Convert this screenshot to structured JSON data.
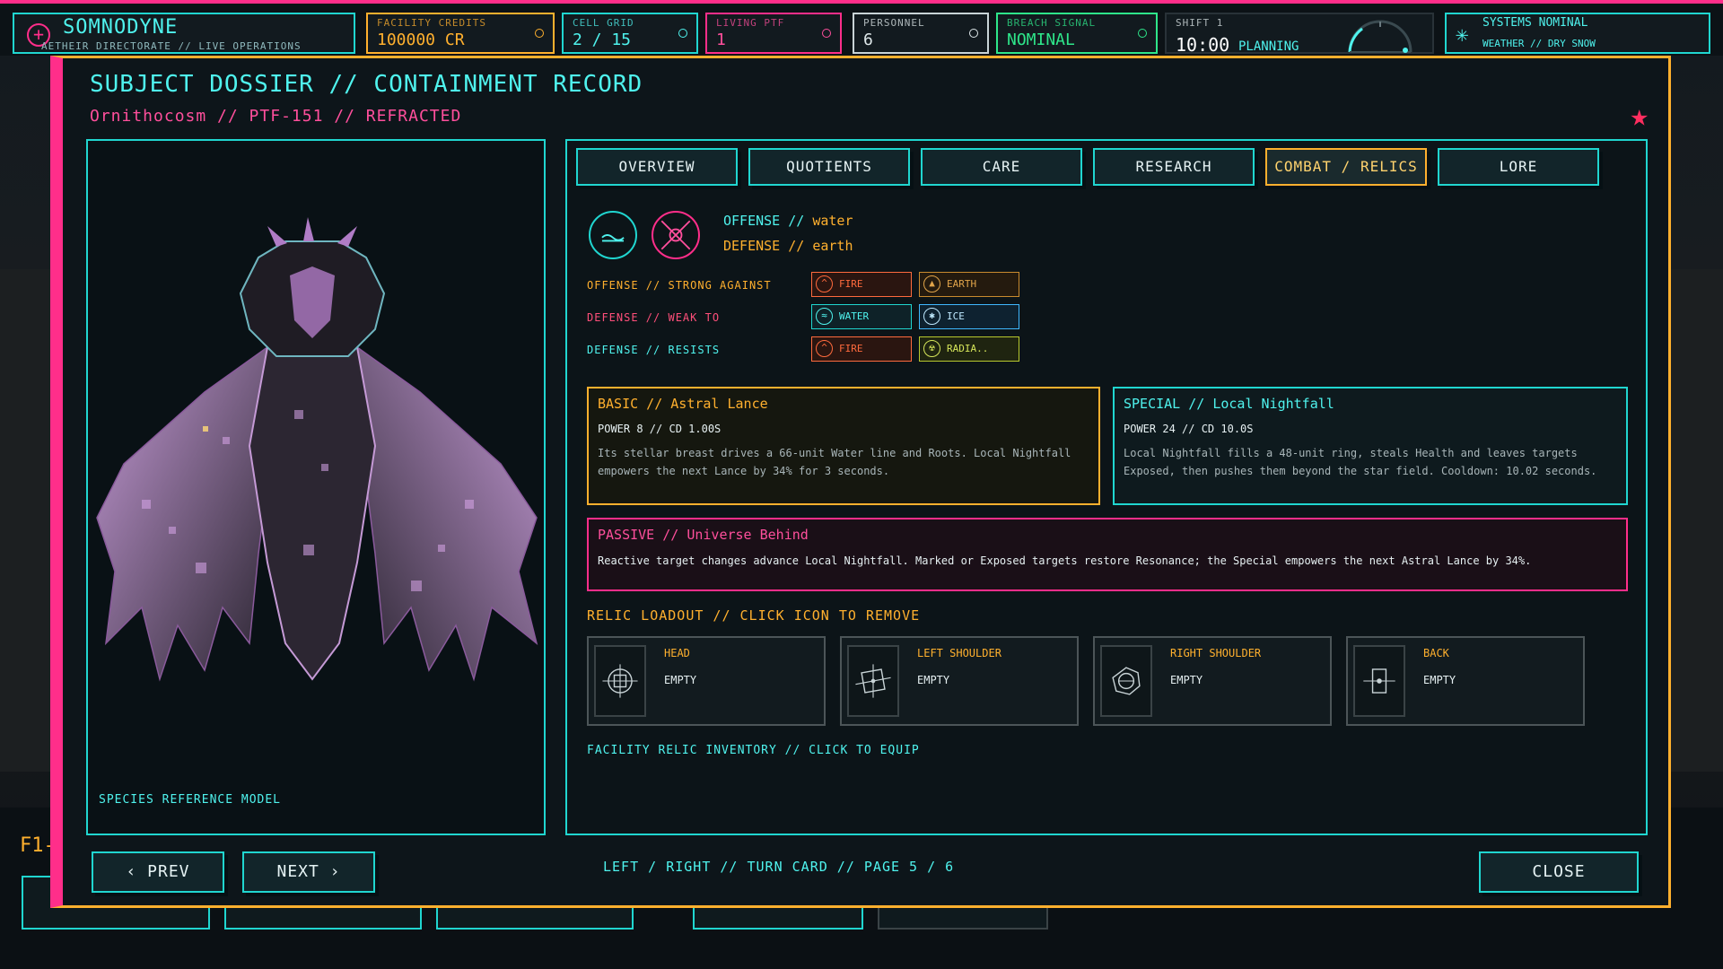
{
  "hud": {
    "brand": {
      "title": "SOMNODYNE",
      "subtitle": "AETHEIR DIRECTORATE // LIVE OPERATIONS"
    },
    "credits": {
      "label": "FACILITY CREDITS",
      "value": "100000 CR"
    },
    "cells": {
      "label": "CELL GRID",
      "value": "2 / 15"
    },
    "living": {
      "label": "LIVING PTF",
      "value": "1"
    },
    "personnel": {
      "label": "PERSONNEL",
      "value": "6"
    },
    "breach": {
      "label": "BREACH SIGNAL",
      "value": "NOMINAL"
    },
    "shift": {
      "label": "SHIFT 1",
      "time": "10:00",
      "mode": "PLANNING"
    },
    "status": {
      "title": "SYSTEMS NOMINAL",
      "weather": "WEATHER // DRY SNOW"
    }
  },
  "modal": {
    "title": "SUBJECT DOSSIER // CONTAINMENT RECORD",
    "subtitle": "Ornithocosm // PTF-151 // REFRACTED",
    "model_caption": "SPECIES REFERENCE MODEL",
    "tabs": [
      {
        "label": "OVERVIEW"
      },
      {
        "label": "QUOTIENTS"
      },
      {
        "label": "CARE"
      },
      {
        "label": "RESEARCH"
      },
      {
        "label": "COMBAT / RELICS"
      },
      {
        "label": "LORE"
      }
    ],
    "active_tab": "COMBAT / RELICS",
    "affinity": {
      "offense_label": "OFFENSE // ",
      "offense_value": "water",
      "defense_label": "DEFENSE // ",
      "defense_value": "earth"
    },
    "matchups": [
      {
        "label": "OFFENSE // STRONG AGAINST",
        "chips": [
          {
            "name": "FIRE"
          },
          {
            "name": "EARTH"
          }
        ]
      },
      {
        "label": "DEFENSE // WEAK TO",
        "chips": [
          {
            "name": "WATER"
          },
          {
            "name": "ICE"
          }
        ]
      },
      {
        "label": "DEFENSE // RESISTS",
        "chips": [
          {
            "name": "FIRE"
          },
          {
            "name": "RADIA.."
          }
        ]
      }
    ],
    "basic": {
      "title": "BASIC // Astral Lance",
      "stats": "POWER 8 // CD 1.00S",
      "desc": "Its stellar breast drives a 66-unit Water line and Roots. Local Nightfall empowers the next Lance by 34% for 3 seconds."
    },
    "special": {
      "title": "SPECIAL // Local Nightfall",
      "stats": "POWER 24 // CD 10.0S",
      "desc": "Local Nightfall fills a 48-unit ring, steals Health and leaves targets Exposed, then pushes them beyond the star field. Cooldown: 10.02 seconds."
    },
    "passive": {
      "title": "PASSIVE // Universe Behind",
      "desc": "Reactive target changes advance Local Nightfall. Marked or Exposed targets restore Resonance; the Special empowers the next Astral Lance by 34%."
    },
    "relic_title": "RELIC LOADOUT // CLICK ICON TO REMOVE",
    "slots": [
      {
        "name": "HEAD",
        "value": "EMPTY"
      },
      {
        "name": "LEFT SHOULDER",
        "value": "EMPTY"
      },
      {
        "name": "RIGHT SHOULDER",
        "value": "EMPTY"
      },
      {
        "name": "BACK",
        "value": "EMPTY"
      }
    ],
    "inventory_title": "FACILITY RELIC INVENTORY // CLICK TO EQUIP",
    "prev": "‹ PREV",
    "next": "NEXT ›",
    "hint": "LEFT / RIGHT // TURN CARD // PAGE 5 / 6",
    "close": "CLOSE"
  },
  "dock": {
    "f1": "F1-"
  },
  "colors": {
    "cyan": "#20d6d0",
    "magenta": "#ff2e8a",
    "amber": "#ffb02e",
    "green": "#2ee68a"
  }
}
